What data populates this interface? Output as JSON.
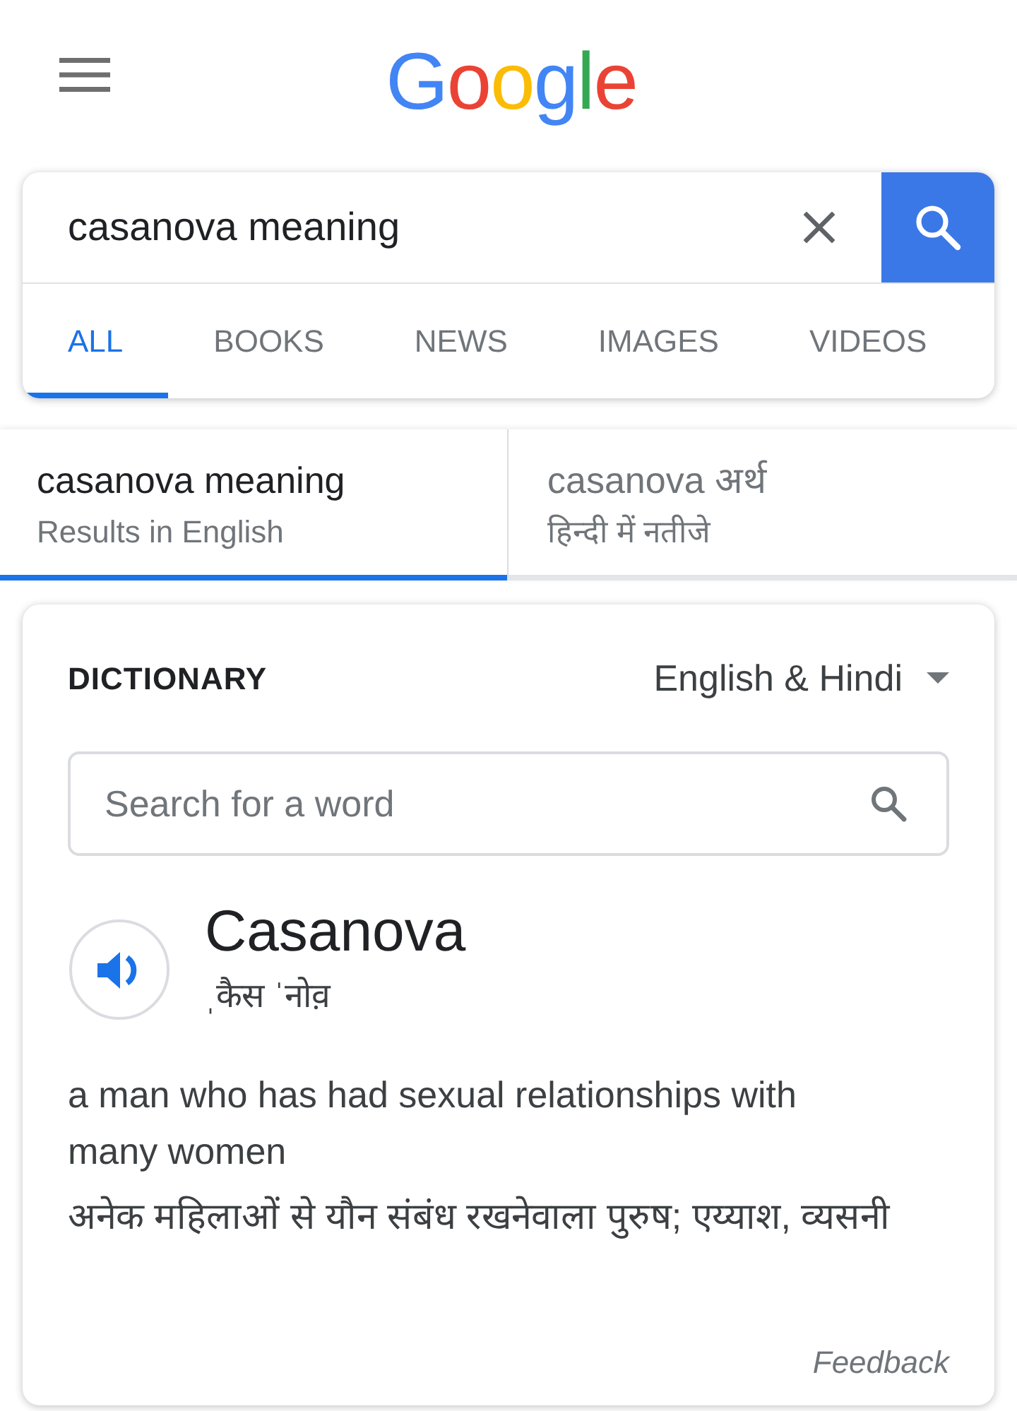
{
  "header": {
    "logo": [
      {
        "text": "G",
        "color": "#4285f4"
      },
      {
        "text": "o",
        "color": "#ea4335"
      },
      {
        "text": "o",
        "color": "#fbbc05"
      },
      {
        "text": "g",
        "color": "#4285f4"
      },
      {
        "text": "l",
        "color": "#34a853"
      },
      {
        "text": "e",
        "color": "#ea4335"
      }
    ]
  },
  "search": {
    "query": "casanova meaning"
  },
  "tabs": [
    {
      "label": "ALL",
      "selected": true
    },
    {
      "label": "BOOKS",
      "selected": false
    },
    {
      "label": "NEWS",
      "selected": false
    },
    {
      "label": "IMAGES",
      "selected": false
    },
    {
      "label": "VIDEOS",
      "selected": false
    }
  ],
  "language_tabs": [
    {
      "title": "casanova meaning",
      "subtitle": "Results in English",
      "selected": true
    },
    {
      "title": "casanova अर्थ",
      "subtitle": "हिन्दी में नतीजे",
      "selected": false
    }
  ],
  "dictionary": {
    "heading": "DICTIONARY",
    "language": "English & Hindi",
    "search": {
      "placeholder": "Search for a word"
    },
    "entry": {
      "word": "Casanova",
      "pronunciation": "ˌकैस ˈनोव़",
      "definition": "a man who has had sexual relationships with many women",
      "translation": "अनेक महिलाओं से यौन संबंध रखनेवाला पुरुष; एय्याश, व्यसनी"
    },
    "feedback": "Feedback"
  }
}
